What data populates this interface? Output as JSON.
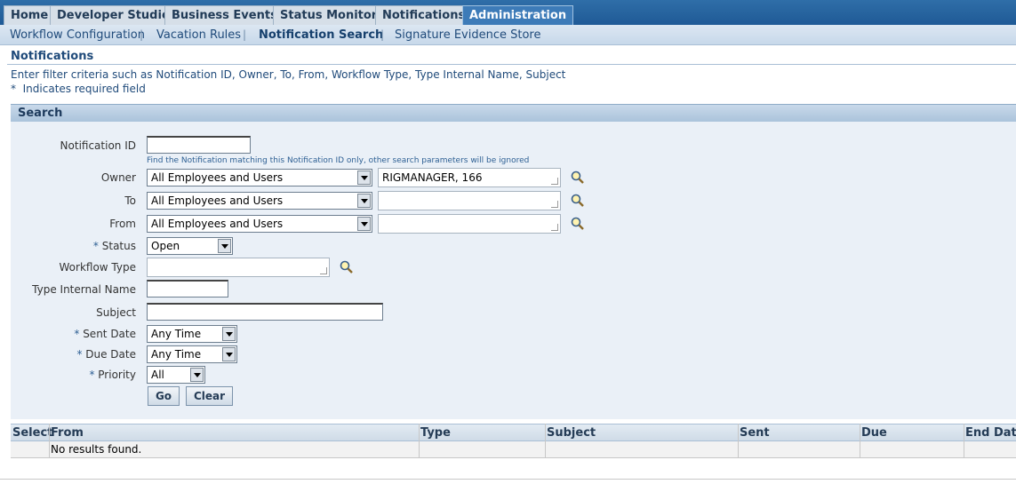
{
  "tabs": [
    "Home",
    "Developer Studio",
    "Business Events",
    "Status Monitor",
    "Notifications",
    "Administration"
  ],
  "active_tab": "Administration",
  "subnav": [
    "Workflow Configuration",
    "Vacation Rules",
    "Notification Search",
    "Signature Evidence Store"
  ],
  "active_subnav": "Notification Search",
  "page": {
    "title": "Notifications",
    "instructions": "Enter filter criteria such as Notification ID, Owner, To, From, Workflow Type, Type Internal Name, Subject",
    "required_note": "Indicates required field",
    "required_star": "*"
  },
  "search": {
    "header": "Search",
    "notification_id_label": "Notification ID",
    "notification_id_value": "",
    "notification_id_hint": "Find the Notification matching this Notification ID only, other search parameters will be ignored",
    "owner_label": "Owner",
    "owner_select": "All Employees and Users",
    "owner_value": "RIGMANAGER, 166",
    "to_label": "To",
    "to_select": "All Employees and Users",
    "to_value": "",
    "from_label": "From",
    "from_select": "All Employees and Users",
    "from_value": "",
    "status_label": "Status",
    "status_value": "Open",
    "workflow_type_label": "Workflow Type",
    "workflow_type_value": "",
    "type_internal_name_label": "Type Internal Name",
    "type_internal_name_value": "",
    "subject_label": "Subject",
    "subject_value": "",
    "sent_date_label": "Sent Date",
    "sent_date_value": "Any Time",
    "due_date_label": "Due Date",
    "due_date_value": "Any Time",
    "priority_label": "Priority",
    "priority_value": "All",
    "go_label": "Go",
    "clear_label": "Clear"
  },
  "results": {
    "columns": [
      "Select",
      "From",
      "Type",
      "Subject",
      "Sent",
      "Due",
      "End Date"
    ],
    "empty_message": "No results found."
  },
  "colors": {
    "tabbar": "#1f5a96",
    "active_tab": "#3d7bb8",
    "link_text": "#1f4a7a",
    "panel_bg": "#eaf0f7"
  }
}
